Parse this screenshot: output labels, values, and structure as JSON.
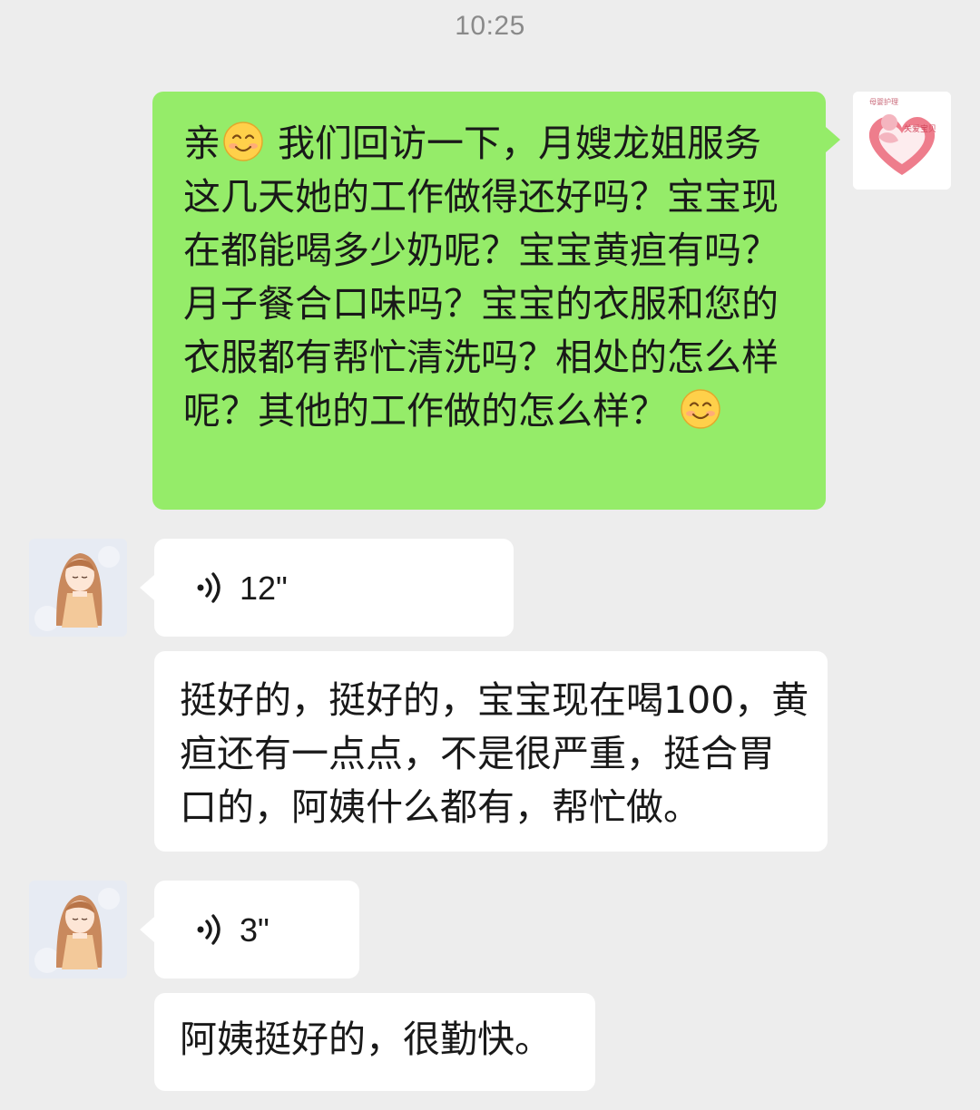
{
  "status": {
    "time": "10:25"
  },
  "messages": {
    "agent_question": {
      "text_1": "亲",
      "text_2": " 我们回访一下，月嫂龙姐服务这几天她的工作做得还好吗？宝宝现在都能喝多少奶呢？宝宝黄疸有吗？月子餐合口味吗？宝宝的衣服和您的衣服都有帮忙清洗吗？相处的怎么样呢？其他的工作做的怎么样？",
      "emoji": "smile-emoji"
    },
    "voice_1": {
      "duration": "12\""
    },
    "reply_1": {
      "text": "挺好的，挺好的，宝宝现在喝100，黄疸还有一点点，不是很严重，挺合胃口的，阿姨什么都有，帮忙做。"
    },
    "voice_2": {
      "duration": "3\""
    },
    "reply_2": {
      "text": "阿姨挺好的，很勤快。"
    }
  },
  "avatars": {
    "self_logo_text_top": "母婴护理",
    "self_logo_text_heart": "关爱宝贝",
    "contact_icon": "girl-avatar"
  },
  "colors": {
    "background": "#ededed",
    "outgoing_bubble": "#95ec69",
    "incoming_bubble": "#ffffff",
    "timestamp": "#8a8a8a"
  }
}
